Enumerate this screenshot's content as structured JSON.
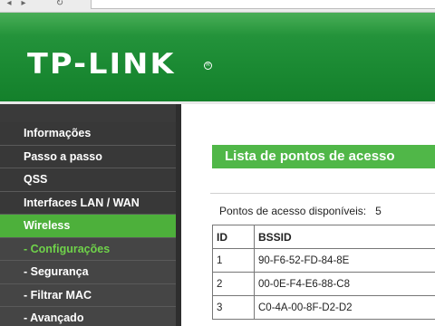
{
  "header": {
    "logo_text": "TP-LINK",
    "logo_mark": "R",
    "brand_color": "#1b8a33"
  },
  "sidebar": {
    "items": [
      {
        "label": "Informações"
      },
      {
        "label": "Passo a passo"
      },
      {
        "label": "QSS"
      },
      {
        "label": "Interfaces LAN / WAN"
      },
      {
        "label": "Wireless"
      },
      {
        "label": "- Configurações"
      },
      {
        "label": "- Segurança"
      },
      {
        "label": "- Filtrar MAC"
      },
      {
        "label": "- Avançado"
      }
    ],
    "active_color": "#4db03b",
    "current_sub_color": "#6fd24a"
  },
  "main": {
    "title": "Lista de pontos de acesso",
    "count_label": "Pontos de acesso disponíveis:",
    "count_value": "5",
    "table": {
      "headers": [
        "ID",
        "BSSID"
      ],
      "rows": [
        {
          "id": "1",
          "bssid": "90-F6-52-FD-84-8E"
        },
        {
          "id": "2",
          "bssid": "00-0E-F4-E6-88-C8"
        },
        {
          "id": "3",
          "bssid": "C0-4A-00-8F-D2-D2"
        }
      ]
    }
  }
}
